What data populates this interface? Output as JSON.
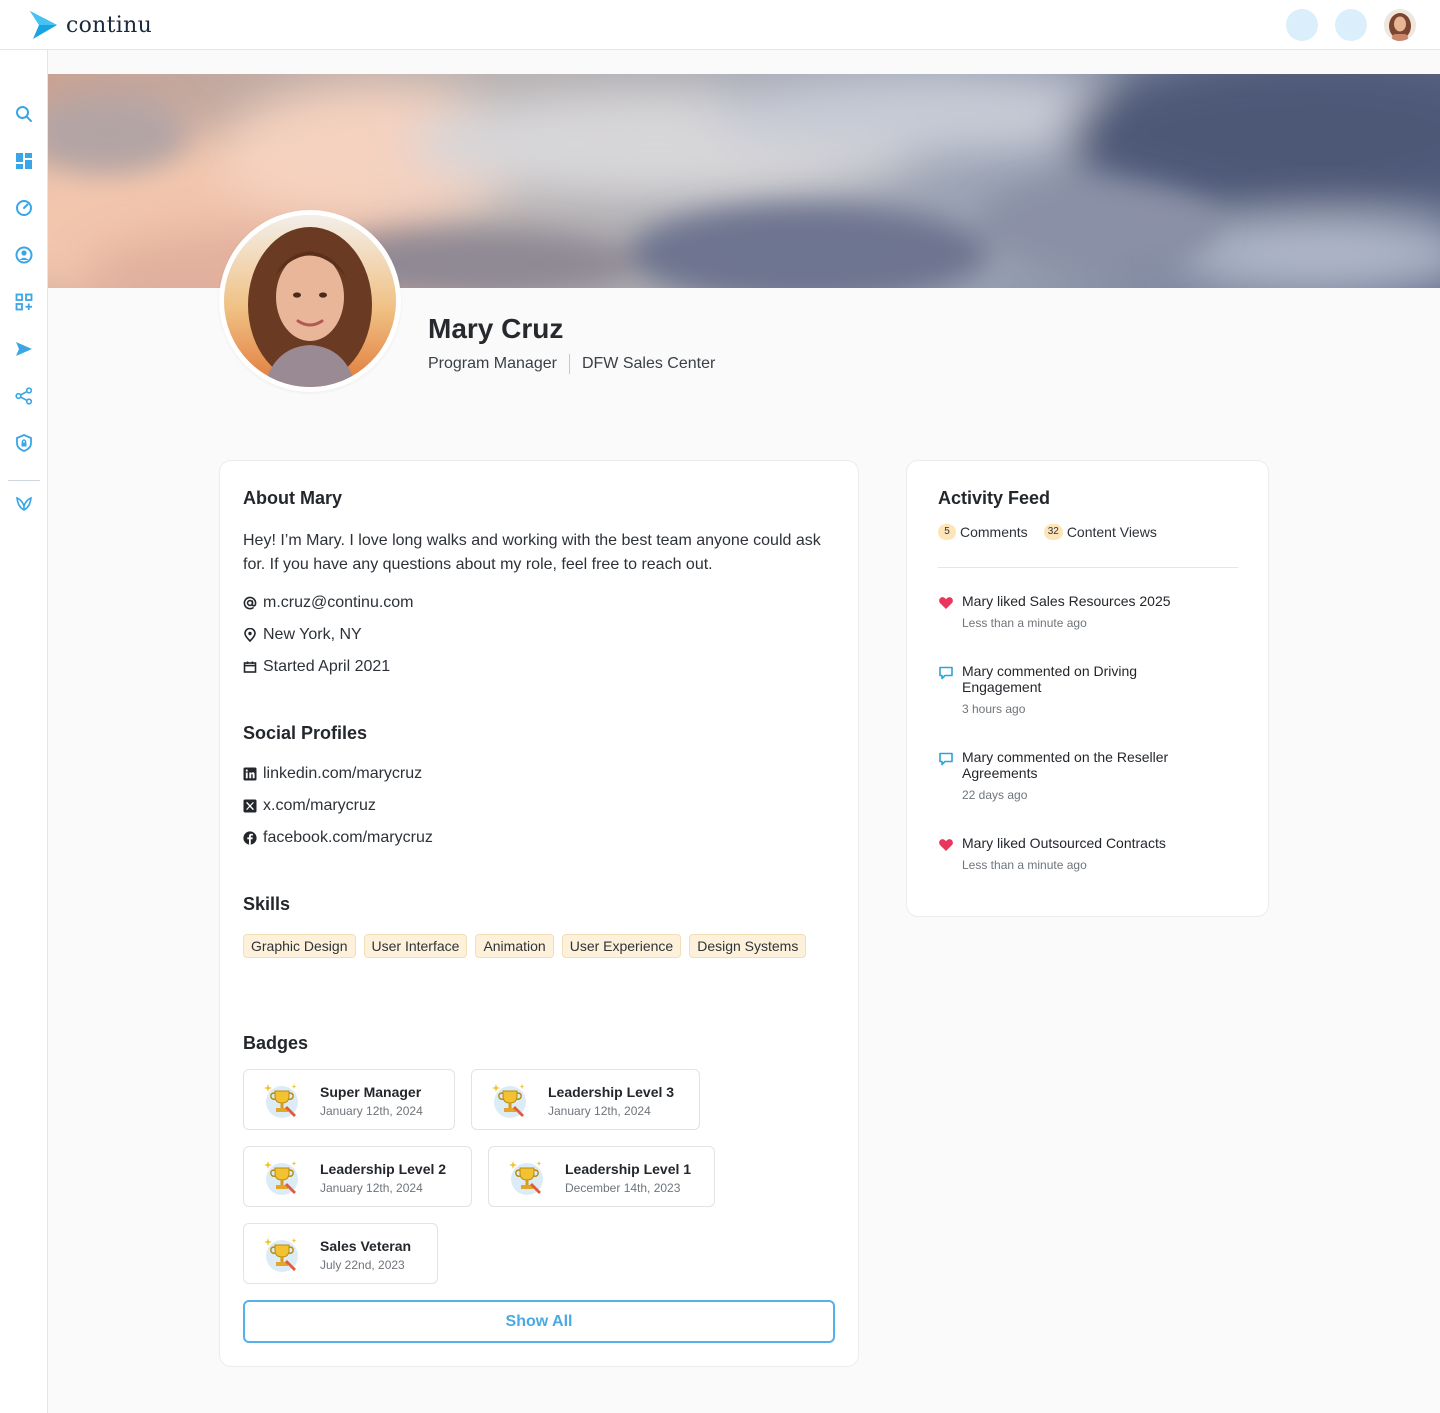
{
  "app": {
    "brand": "continu",
    "accent": "#4aa9e3",
    "icon_names": [
      "search-icon",
      "dashboard-icon",
      "gauge-icon",
      "user-circle-icon",
      "apps-plus-icon",
      "send-icon",
      "share-icon",
      "shield-icon",
      "leaf-icon"
    ]
  },
  "profile": {
    "name": "Mary Cruz",
    "role": "Program Manager",
    "location": "DFW Sales Center"
  },
  "about": {
    "title": "About Mary",
    "text": "Hey! I’m Mary. I love long walks and working with the best team anyone could ask for. If you have any questions about my role, feel free to reach out.",
    "email": "m.cruz@continu.com",
    "city": "New York, NY",
    "started": "Started April 2021"
  },
  "social": {
    "title": "Social Profiles",
    "linkedin": "linkedin.com/marycruz",
    "x": "x.com/marycruz",
    "facebook": "facebook.com/marycruz"
  },
  "skills": {
    "title": "Skills",
    "items": [
      "Graphic Design",
      "User Interface",
      "Animation",
      "User Experience",
      "Design Systems"
    ]
  },
  "badges": {
    "title": "Badges",
    "items": [
      {
        "name": "Super Manager",
        "date": "January 12th, 2024"
      },
      {
        "name": "Leadership Level 3",
        "date": "January 12th, 2024"
      },
      {
        "name": "Leadership Level 2",
        "date": "January 12th, 2024"
      },
      {
        "name": "Leadership Level 1",
        "date": "December 14th, 2023"
      },
      {
        "name": "Sales Veteran",
        "date": "July 22nd, 2023"
      }
    ],
    "show_all": "Show All"
  },
  "feed": {
    "title": "Activity Feed",
    "comments_count": "5",
    "comments_label": "Comments",
    "views_count": "32",
    "views_label": "Content Views",
    "items": [
      {
        "type": "like",
        "text": "Mary liked Sales Resources 2025",
        "time": "Less than a minute ago"
      },
      {
        "type": "comment",
        "text": "Mary commented on Driving Engagement",
        "time": "3 hours ago"
      },
      {
        "type": "comment",
        "text": "Mary commented on the Reseller Agreements",
        "time": "22 days ago"
      },
      {
        "type": "like",
        "text": "Mary liked Outsourced Contracts",
        "time": "Less than a minute ago"
      }
    ]
  }
}
